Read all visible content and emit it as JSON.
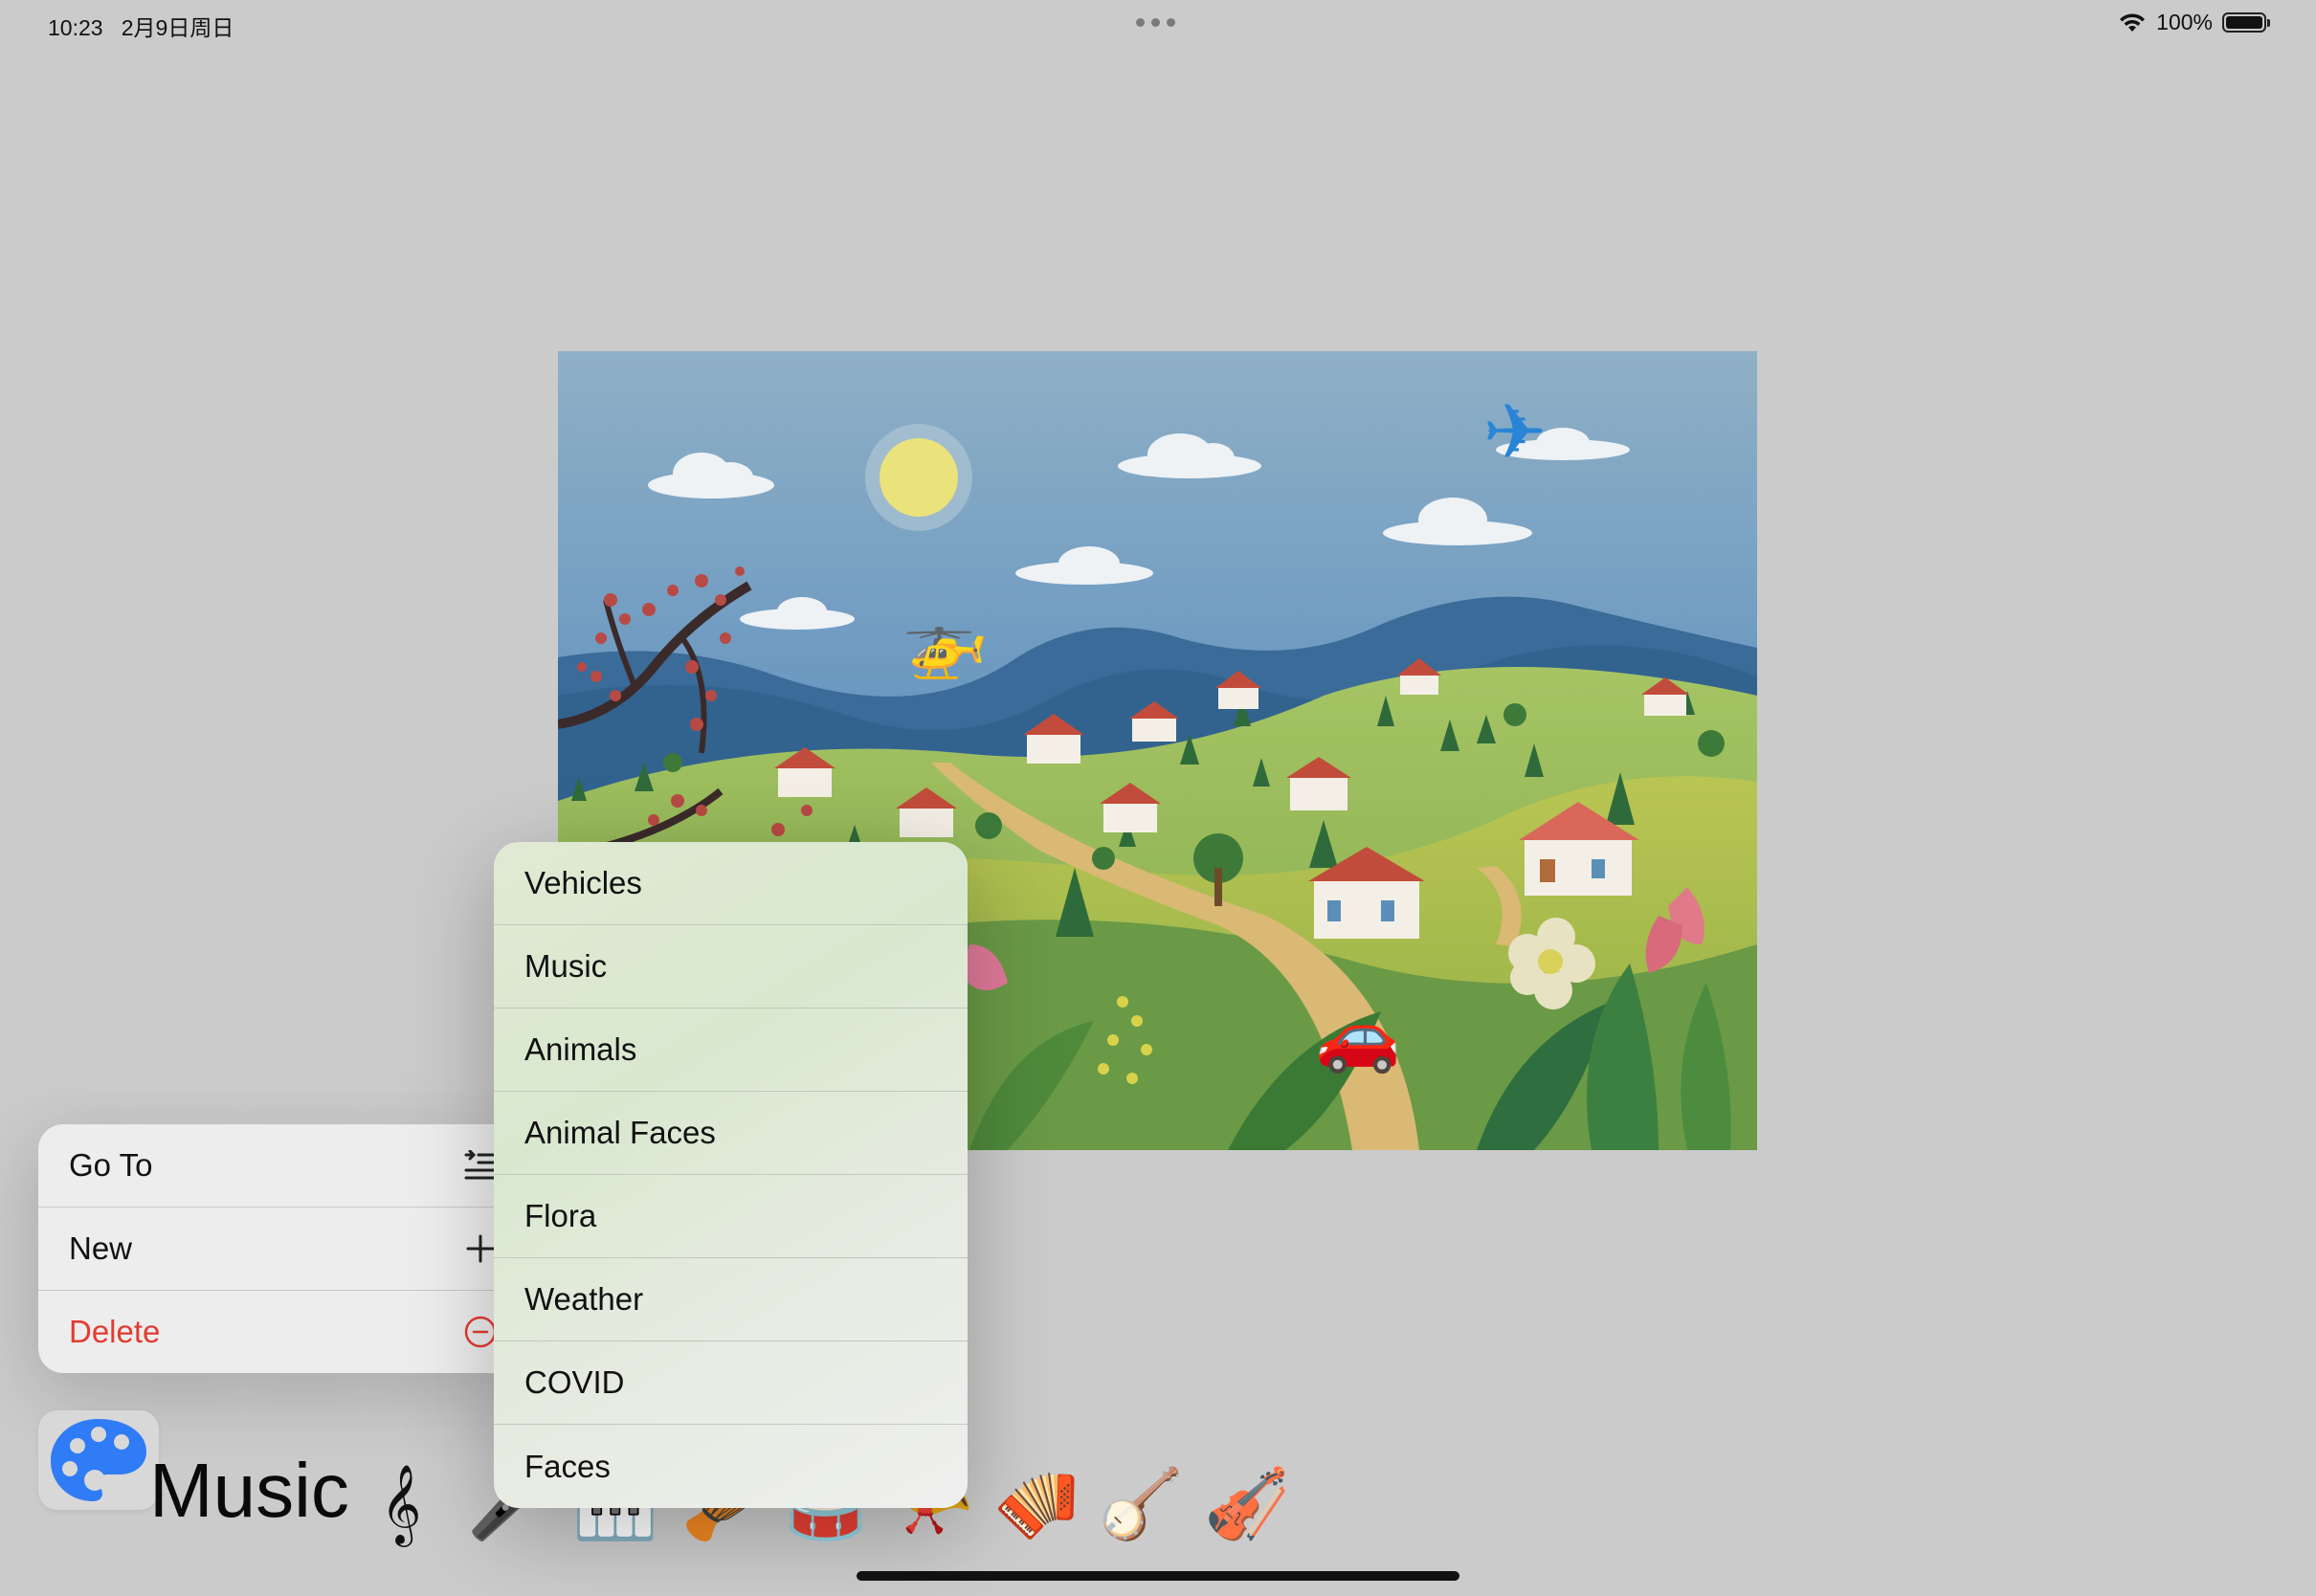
{
  "status_bar": {
    "time": "10:23",
    "date": "2月9日周日",
    "battery": "100%"
  },
  "context_menu": {
    "items": [
      {
        "label": "Go To",
        "icon": "list-indent-icon"
      },
      {
        "label": "New",
        "icon": "plus-icon"
      },
      {
        "label": "Delete",
        "icon": "minus-circle-icon",
        "color": "#e23b30"
      }
    ]
  },
  "submenu": {
    "items": [
      "Vehicles",
      "Music",
      "Animals",
      "Animal Faces",
      "Flora",
      "Weather",
      "COVID",
      "Faces"
    ]
  },
  "bottom_bar": {
    "palette_icon": "palette-icon",
    "category_title": "Music",
    "emojis": [
      {
        "name": "treble-clef-icon",
        "glyph": "𝄞"
      },
      {
        "name": "microphone-icon",
        "glyph": "🎤"
      },
      {
        "name": "piano-keys-icon",
        "glyph": "🎹"
      },
      {
        "name": "long-drum-icon",
        "glyph": "🪘"
      },
      {
        "name": "drum-icon",
        "glyph": "🥁"
      },
      {
        "name": "horn-icon",
        "glyph": "📯"
      },
      {
        "name": "accordion-icon",
        "glyph": "🪗"
      },
      {
        "name": "banjo-icon",
        "glyph": "🪕"
      },
      {
        "name": "violin-icon",
        "glyph": "🎻"
      }
    ]
  },
  "scene": {
    "sprites": [
      {
        "name": "airplane-sprite",
        "glyph": "✈"
      },
      {
        "name": "helicopter-sprite",
        "glyph": "🚁"
      },
      {
        "name": "car-sprite",
        "glyph": "🚗"
      }
    ]
  }
}
